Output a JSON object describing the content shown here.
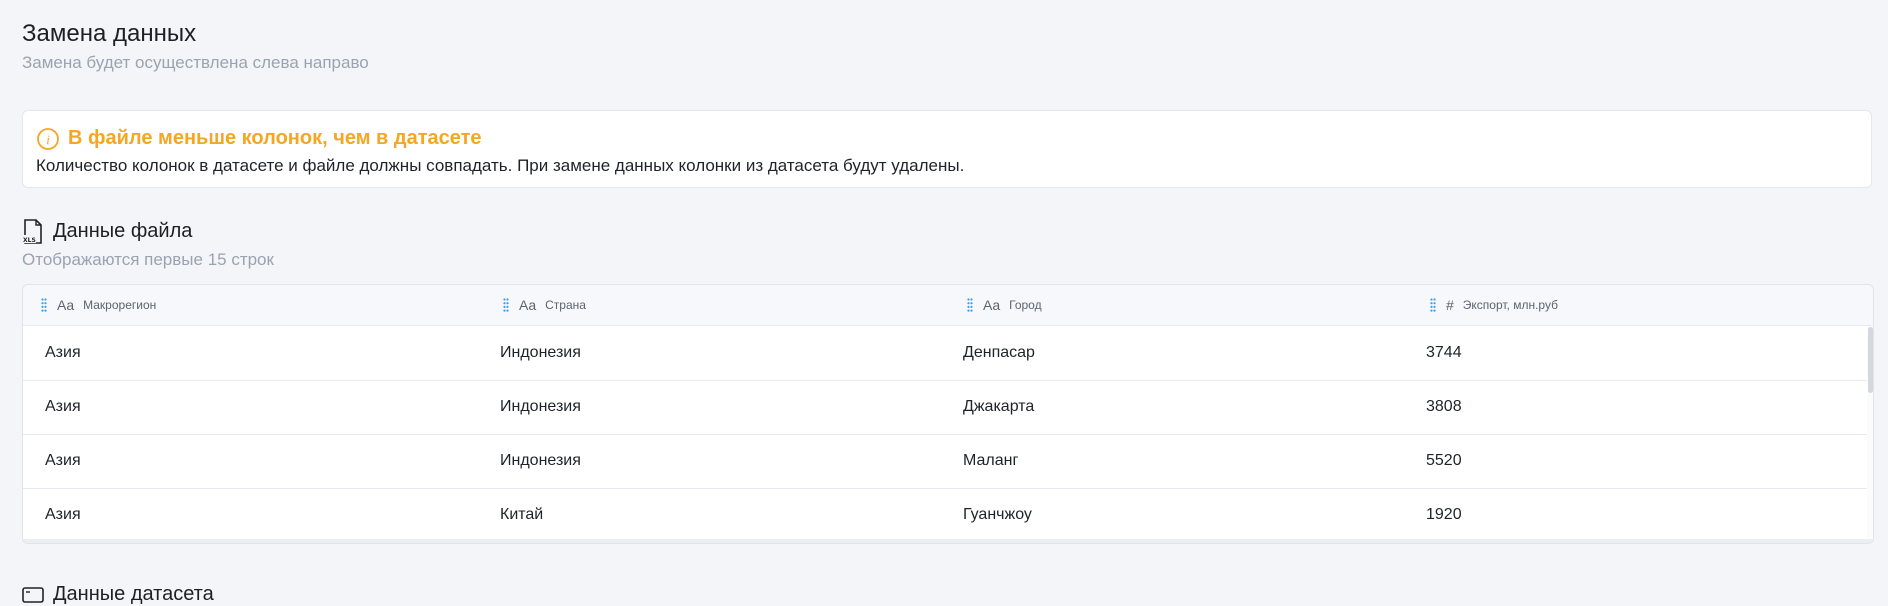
{
  "page": {
    "title": "Замена данных",
    "subtitle": "Замена будет осуществлена слева направо"
  },
  "alert": {
    "icon": "info-icon",
    "color": "#f5a623",
    "title": "В файле меньше колонок, чем в датасете",
    "text": "Количество колонок в датасете и файле должны совпадать. При замене данных колонки из датасета будут удалены."
  },
  "file_section": {
    "icon": "xls-file-icon",
    "title": "Данные файла",
    "subtitle": "Отображаются первые 15 строк"
  },
  "table": {
    "columns": [
      {
        "type_icon": "Aa",
        "label": "Макрорегион"
      },
      {
        "type_icon": "Aa",
        "label": "Страна"
      },
      {
        "type_icon": "Aa",
        "label": "Город"
      },
      {
        "type_icon": "#",
        "label": "Экспорт, млн.руб"
      }
    ],
    "rows": [
      [
        "Азия",
        "Индонезия",
        "Денпасар",
        "3744"
      ],
      [
        "Азия",
        "Индонезия",
        "Джакарта",
        "3808"
      ],
      [
        "Азия",
        "Индонезия",
        "Маланг",
        "5520"
      ],
      [
        "Азия",
        "Китай",
        "Гуанчжоу",
        "1920"
      ]
    ]
  },
  "dataset_section": {
    "icon": "dataset-icon",
    "title": "Данные датасета"
  }
}
